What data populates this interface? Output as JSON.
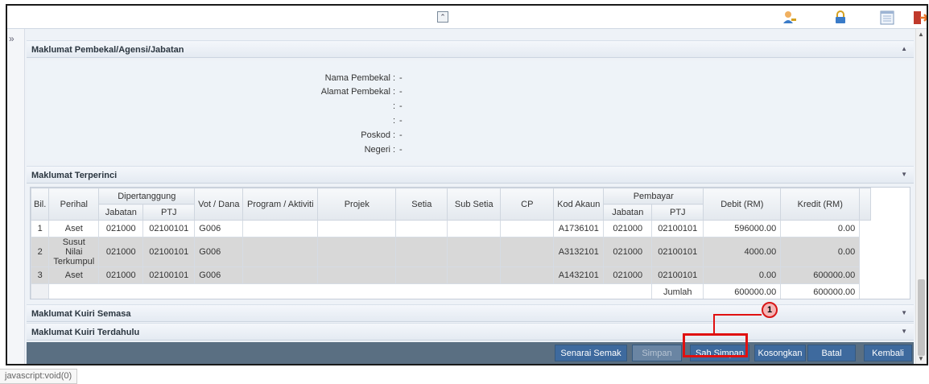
{
  "topbar": {
    "collapse_icon": "double-chevron-up-icon",
    "icons": [
      "user-key-icon",
      "lock-icon",
      "list-icon",
      "logout-icon"
    ]
  },
  "sidebar": {
    "expand_icon": "double-chevron-right-icon"
  },
  "sections": {
    "supplier": {
      "title": "Maklumat Pembekal/Agensi/Jabatan",
      "fields": [
        {
          "label": "Nama Pembekal",
          "sep": ":",
          "value": "-"
        },
        {
          "label": "Alamat Pembekal",
          "sep": ":",
          "value": "-"
        },
        {
          "label": "",
          "sep": ":",
          "value": "-"
        },
        {
          "label": "",
          "sep": ":",
          "value": "-"
        },
        {
          "label": "Poskod",
          "sep": ":",
          "value": "-"
        },
        {
          "label": "Negeri",
          "sep": ":",
          "value": "-"
        }
      ]
    },
    "details": {
      "title": "Maklumat Terperinci",
      "headers": {
        "bil": "Bil.",
        "perihal": "Perihal",
        "dipertanggung": "Dipertanggung",
        "jabatan": "Jabatan",
        "ptj": "PTJ",
        "vot": "Vot / Dana",
        "program": "Program / Aktiviti",
        "projek": "Projek",
        "setia": "Setia",
        "subsetia": "Sub Setia",
        "cp": "CP",
        "kodakaun": "Kod Akaun",
        "pembayar": "Pembayar",
        "pjabatan": "Jabatan",
        "pptj": "PTJ",
        "debit": "Debit (RM)",
        "kredit": "Kredit (RM)"
      },
      "rows": [
        {
          "bil": "1",
          "perihal": "Aset",
          "jabatan": "021000",
          "ptj": "02100101",
          "vot": "G006",
          "program": "",
          "projek": "",
          "setia": "",
          "subsetia": "",
          "cp": "",
          "kodakaun": "A1736101",
          "pjabatan": "021000",
          "pptj": "02100101",
          "debit": "596000.00",
          "kredit": "0.00"
        },
        {
          "bil": "2",
          "perihal": "Susut Nilai Terkumpul",
          "jabatan": "021000",
          "ptj": "02100101",
          "vot": "G006",
          "program": "",
          "projek": "",
          "setia": "",
          "subsetia": "",
          "cp": "",
          "kodakaun": "A3132101",
          "pjabatan": "021000",
          "pptj": "02100101",
          "debit": "4000.00",
          "kredit": "0.00"
        },
        {
          "bil": "3",
          "perihal": "Aset",
          "jabatan": "021000",
          "ptj": "02100101",
          "vot": "G006",
          "program": "",
          "projek": "",
          "setia": "",
          "subsetia": "",
          "cp": "",
          "kodakaun": "A1432101",
          "pjabatan": "021000",
          "pptj": "02100101",
          "debit": "0.00",
          "kredit": "600000.00"
        }
      ],
      "total": {
        "label": "Jumlah",
        "debit": "600000.00",
        "kredit": "600000.00"
      }
    },
    "kuiri_semasa": {
      "title": "Maklumat Kuiri Semasa"
    },
    "kuiri_terdahulu": {
      "title": "Maklumat Kuiri Terdahulu"
    }
  },
  "toolbar": {
    "senarai_semak": "Senarai Semak",
    "simpan": "Simpan",
    "sah_simpan": "Sah Simpan",
    "kosongkan": "Kosongkan",
    "batal": "Batal",
    "kembali": "Kembali"
  },
  "callout": {
    "number": "1",
    "color": "#e01010"
  },
  "statusbar": {
    "text": "javascript:void(0)"
  }
}
